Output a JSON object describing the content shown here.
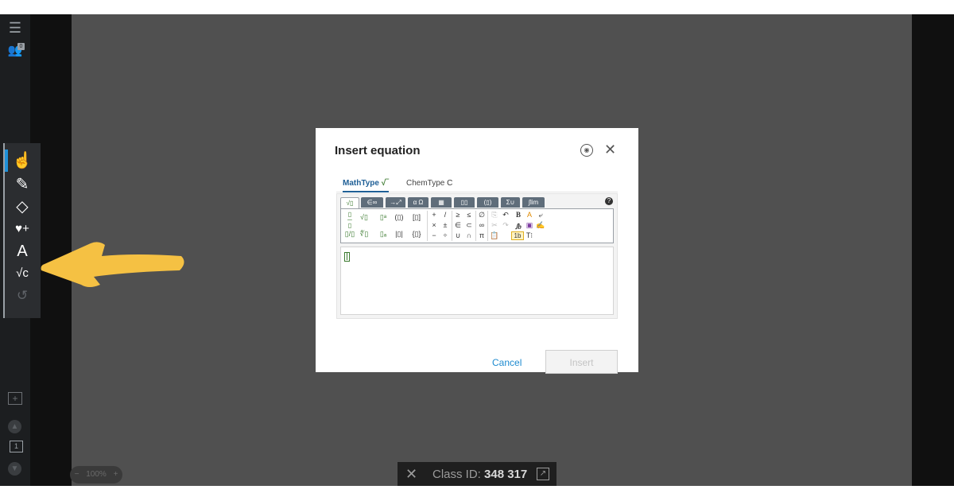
{
  "sidebar": {
    "users_badge": "0",
    "page_number": "1"
  },
  "toolbar": {
    "items": [
      {
        "name": "pointer",
        "glyph": "☝"
      },
      {
        "name": "pen",
        "glyph": "✎"
      },
      {
        "name": "eraser",
        "glyph": "◇"
      },
      {
        "name": "add-media",
        "glyph": "♥+"
      },
      {
        "name": "text",
        "glyph": "A"
      },
      {
        "name": "math",
        "glyph": "√c"
      },
      {
        "name": "undo",
        "glyph": "↺"
      }
    ]
  },
  "zoom": {
    "label": "100%",
    "minus": "−",
    "plus": "+"
  },
  "class_bar": {
    "prefix": "Class ID:",
    "id": "348 317"
  },
  "dialog": {
    "title": "Insert equation",
    "tabs": [
      {
        "label": "MathType"
      },
      {
        "label": "ChemType"
      }
    ],
    "cancel_label": "Cancel",
    "insert_label": "Insert"
  },
  "palette": {
    "tabs": [
      "√▯",
      "∈∞",
      "→⤢",
      "α Ω",
      "▦",
      "▯▯",
      "(▯)",
      "Σ∪",
      "∫lim"
    ],
    "row1": [
      "+",
      "/",
      "≥",
      "≤",
      "∅"
    ],
    "row2": [
      "×",
      "±",
      "∈",
      "⊂",
      "∞"
    ],
    "row3": [
      "−",
      "÷",
      "∪",
      "∩",
      "π"
    ]
  },
  "colors": {
    "accent": "#1e90d8",
    "arrow": "#f5c143",
    "math_green": "#3b7a2f"
  }
}
